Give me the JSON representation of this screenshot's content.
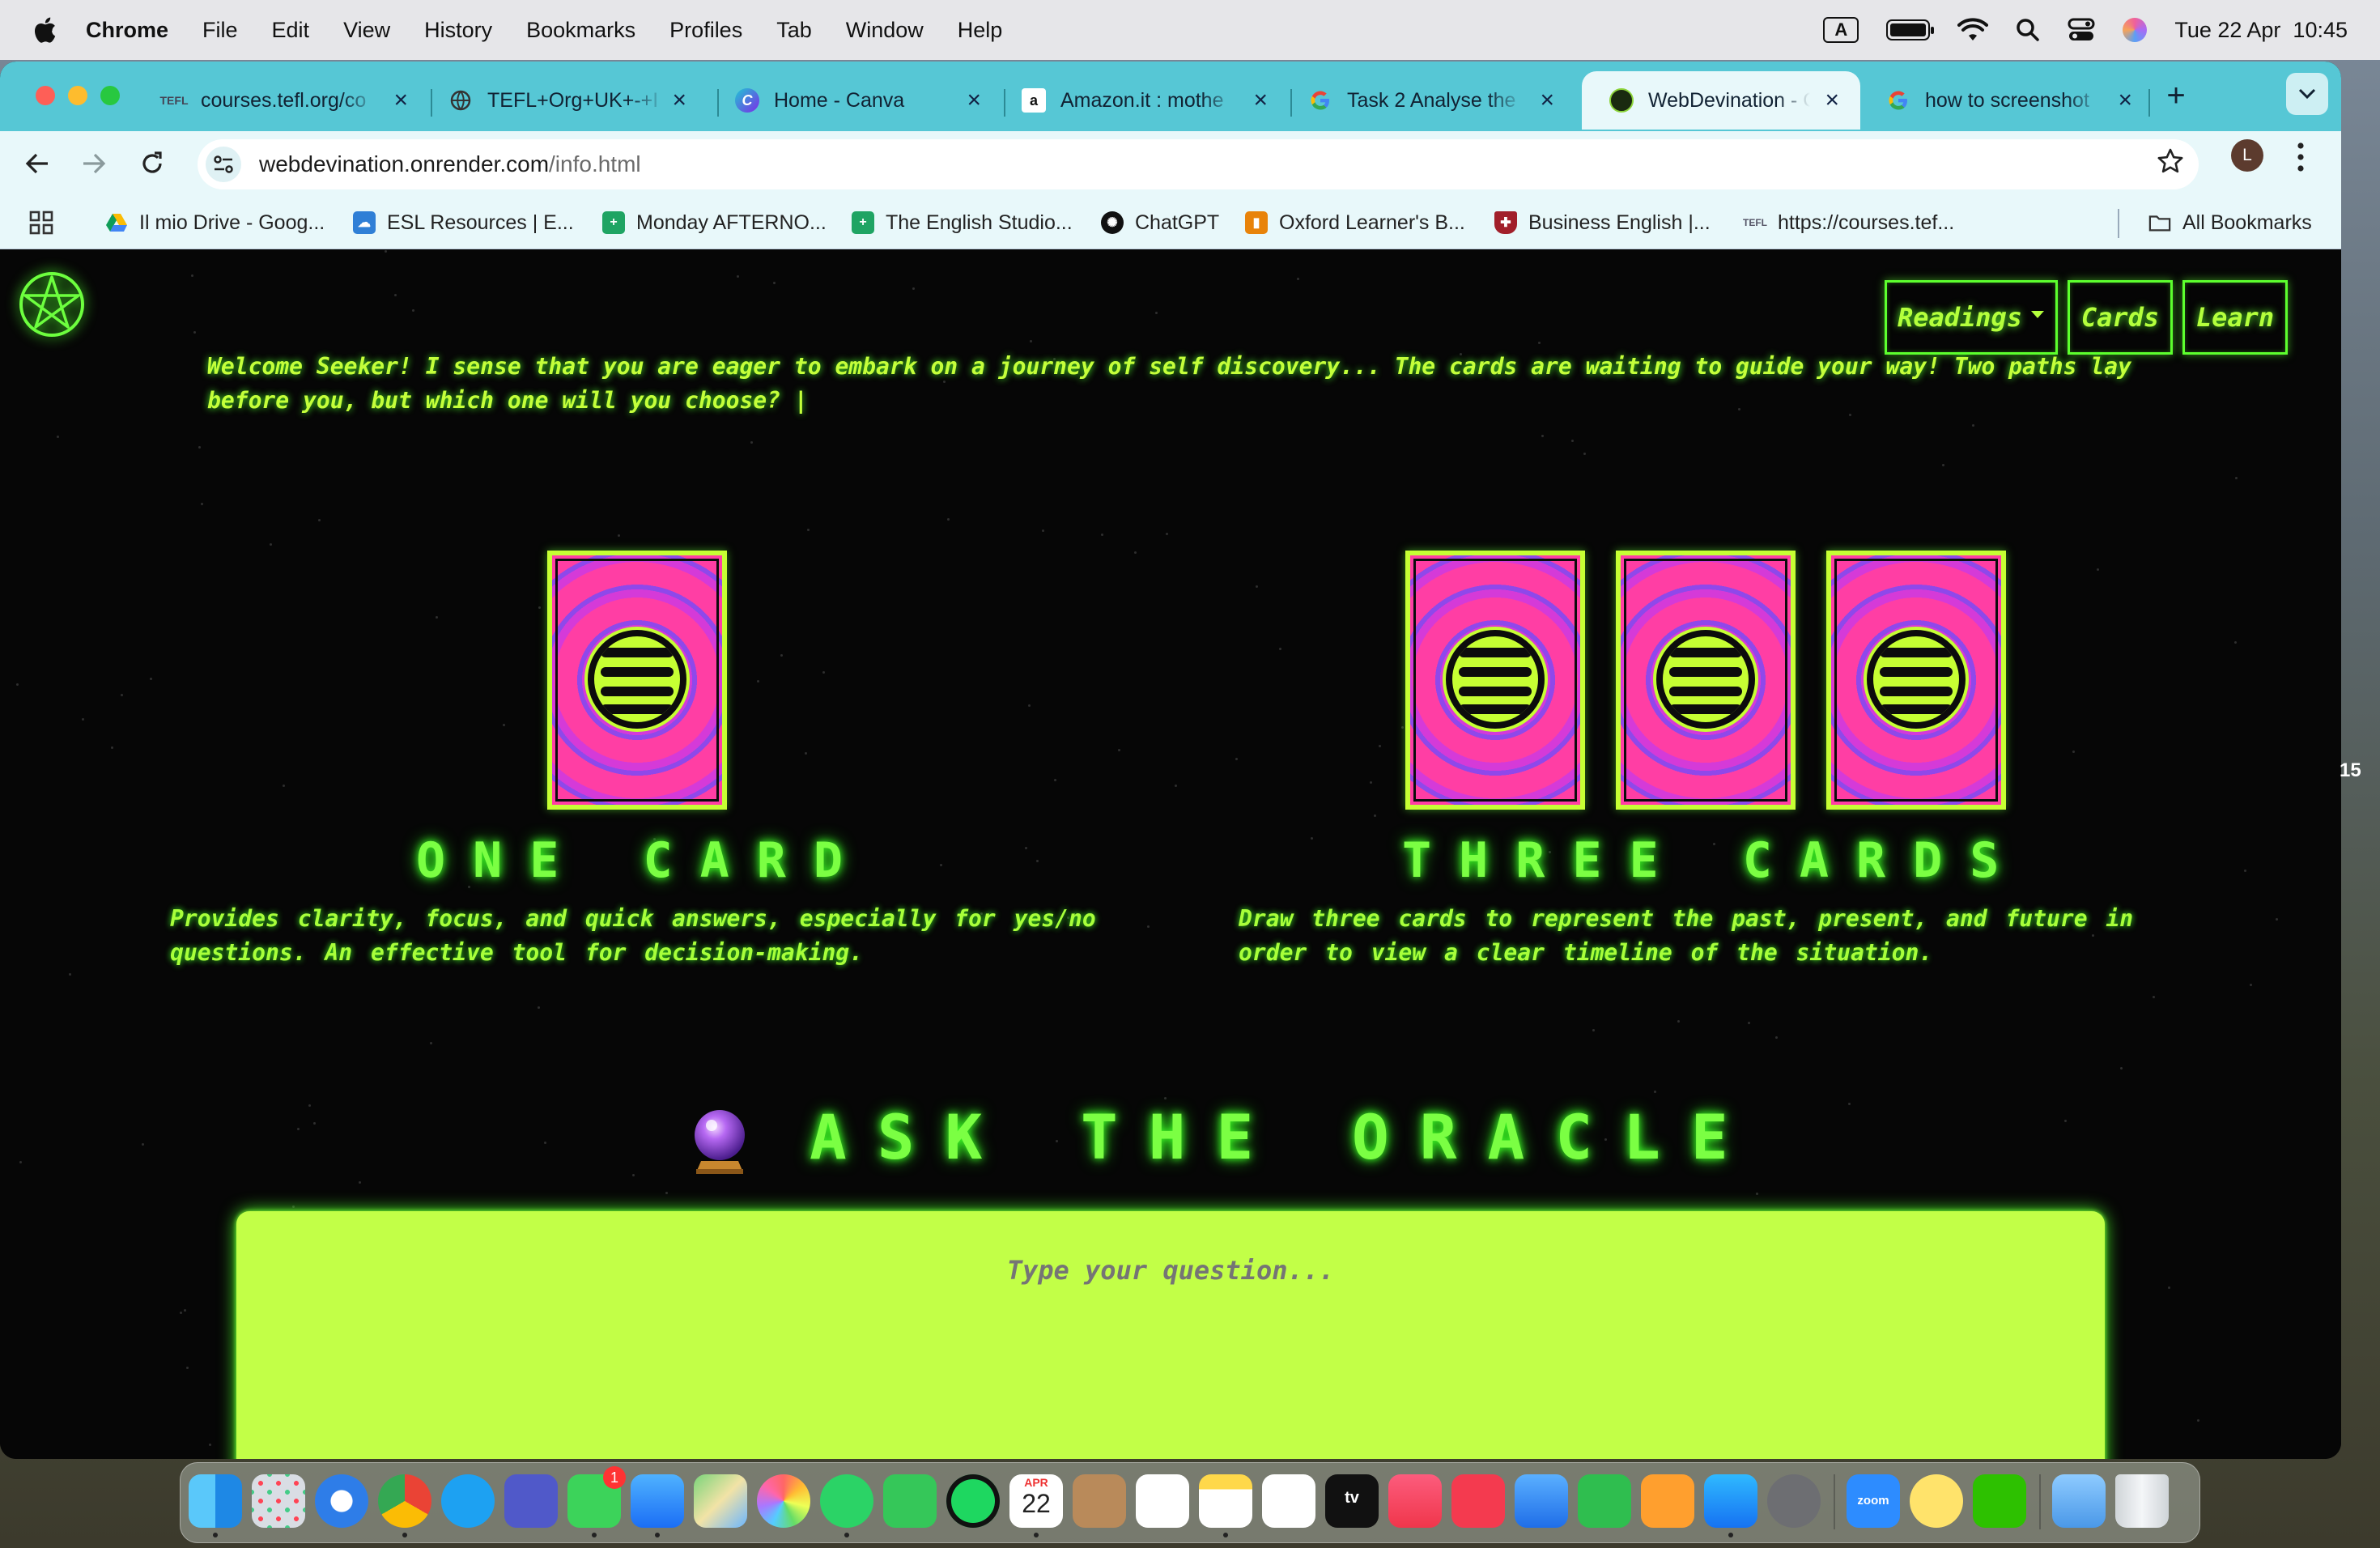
{
  "menubar": {
    "app_name": "Chrome",
    "menus": [
      "File",
      "Edit",
      "View",
      "History",
      "Bookmarks",
      "Profiles",
      "Tab",
      "Window",
      "Help"
    ],
    "input_indicator": "A",
    "clock": "Tue 22 Apr  10:45"
  },
  "browser": {
    "tabs": [
      {
        "title": "courses.tefl.org/co",
        "favicon": "tefl-icon"
      },
      {
        "title": "TEFL+Org+UK+-+I",
        "favicon": "globe-icon"
      },
      {
        "title": "Home - Canva",
        "favicon": "canva-icon"
      },
      {
        "title": "Amazon.it : mothe",
        "favicon": "amazon-icon"
      },
      {
        "title": "Task 2 Analyse the",
        "favicon": "google-icon"
      },
      {
        "title": "WebDevination - C",
        "favicon": "webdevination-icon",
        "active": true
      },
      {
        "title": "how to screenshot",
        "favicon": "google-icon"
      }
    ],
    "new_tab_label": "+",
    "url_host": "webdevination.onrender.com",
    "url_path": "/info.html",
    "profile_initial": "L",
    "bookmarks": [
      {
        "label": "Il mio Drive - Goog...",
        "icon": "drive-icon"
      },
      {
        "label": "ESL Resources | E...",
        "icon": "cloud-icon"
      },
      {
        "label": "Monday AFTERNO...",
        "icon": "sheets-icon"
      },
      {
        "label": "The English Studio...",
        "icon": "sheets-icon"
      },
      {
        "label": "ChatGPT",
        "icon": "chatgpt-icon"
      },
      {
        "label": "Oxford Learner's B...",
        "icon": "oxford-icon"
      },
      {
        "label": "Business English |...",
        "icon": "shield-icon"
      },
      {
        "label": "https://courses.tef...",
        "icon": "tefl-icon"
      }
    ],
    "all_bookmarks_label": "All Bookmarks"
  },
  "site": {
    "nav": {
      "readings": "Readings",
      "cards": "Cards",
      "learn": "Learn"
    },
    "welcome_text": "Welcome Seeker! I sense that you are eager to embark on a journey of self discovery... The cards are waiting to guide your way! Two paths lay before you, but which one will you choose? |",
    "one_card": {
      "title": "ONE CARD",
      "description": "Provides clarity, focus, and quick answers, especially for yes/no questions. An effective tool for decision-making."
    },
    "three_cards": {
      "title": "THREE CARDS",
      "description": "Draw three cards to represent the past, present, and future in order to view a clear timeline of the situation."
    },
    "oracle": {
      "title": "ASK THE ORACLE",
      "placeholder": "Type your question..."
    }
  },
  "side_text": "15",
  "dock": {
    "apps": [
      "finder",
      "launchpad",
      "safari",
      "chrome",
      "skype",
      "teams",
      "messages",
      "mail",
      "maps",
      "photos",
      "whatsapp",
      "facetime",
      "spotify",
      "calendar",
      "contacts",
      "reminders",
      "notes",
      "freeform",
      "tv",
      "music",
      "news",
      "keynote",
      "numbers",
      "pages",
      "app-store",
      "system-settings",
      "zoom",
      "tips",
      "wechat",
      "downloads",
      "trash"
    ],
    "messages_badge": "1",
    "calendar_month": "APR",
    "calendar_day": "22",
    "tv_label": "tv",
    "zoom_label": "zoom"
  },
  "colors": {
    "neon": "#7bff43",
    "panel": "#c2ff47",
    "tab_strip": "#56c7d5",
    "card_pink": "#ff3ea4"
  }
}
